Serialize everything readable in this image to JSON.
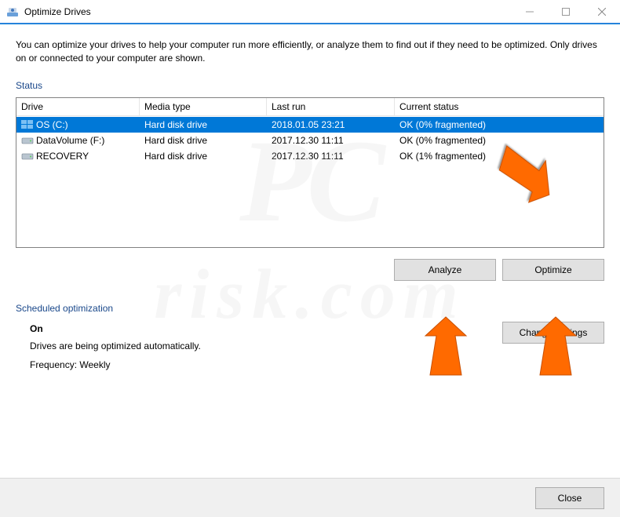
{
  "window": {
    "title": "Optimize Drives"
  },
  "intro": "You can optimize your drives to help your computer run more efficiently, or analyze them to find out if they need to be optimized. Only drives on or connected to your computer are shown.",
  "status_label": "Status",
  "columns": {
    "drive": "Drive",
    "media": "Media type",
    "lastrun": "Last run",
    "status": "Current status"
  },
  "drives": [
    {
      "name": "OS (C:)",
      "media": "Hard disk drive",
      "lastrun": "2018.01.05 23:21",
      "status": "OK (0% fragmented)",
      "selected": true,
      "icon": "windows"
    },
    {
      "name": "DataVolume (F:)",
      "media": "Hard disk drive",
      "lastrun": "2017.12.30 11:11",
      "status": "OK (0% fragmented)",
      "selected": false,
      "icon": "hdd"
    },
    {
      "name": "RECOVERY",
      "media": "Hard disk drive",
      "lastrun": "2017.12.30 11:11",
      "status": "OK (1% fragmented)",
      "selected": false,
      "icon": "hdd"
    }
  ],
  "buttons": {
    "analyze": "Analyze",
    "optimize": "Optimize",
    "change": "Change settings",
    "close": "Close"
  },
  "schedule": {
    "label": "Scheduled optimization",
    "state": "On",
    "desc": "Drives are being optimized automatically.",
    "freq": "Frequency: Weekly"
  },
  "watermark": {
    "line1": "PC",
    "line2": "risk.com"
  }
}
